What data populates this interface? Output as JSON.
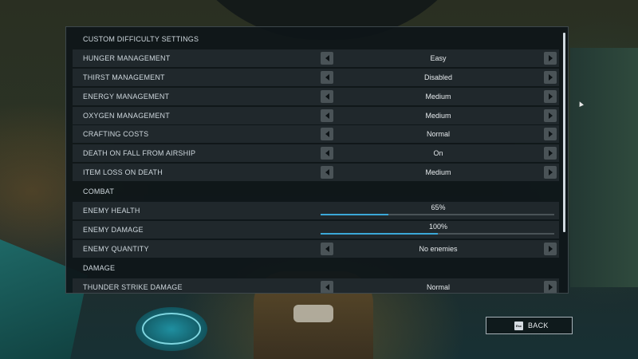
{
  "title": "CUSTOM DIFFICULTY SETTINGS",
  "rows": [
    {
      "label": "HUNGER MANAGEMENT",
      "value": "Easy"
    },
    {
      "label": "THIRST MANAGEMENT",
      "value": "Disabled"
    },
    {
      "label": "ENERGY MANAGEMENT",
      "value": "Medium"
    },
    {
      "label": "OXYGEN MANAGEMENT",
      "value": "Medium"
    },
    {
      "label": "CRAFTING COSTS",
      "value": "Normal"
    },
    {
      "label": "DEATH ON FALL FROM AIRSHIP",
      "value": "On"
    },
    {
      "label": "ITEM LOSS ON DEATH",
      "value": "Medium"
    }
  ],
  "combat": {
    "heading": "COMBAT",
    "enemy_health": {
      "label": "ENEMY HEALTH",
      "value": "65%",
      "level": 0.29
    },
    "enemy_damage": {
      "label": "ENEMY DAMAGE",
      "value": "100%",
      "level": 0.5
    },
    "enemy_quantity": {
      "label": "ENEMY QUANTITY",
      "value": "No enemies"
    }
  },
  "damage": {
    "heading": "DAMAGE",
    "thunder_strike": {
      "label": "THUNDER STRIKE DAMAGE",
      "value": "Normal"
    }
  },
  "back_button": {
    "key_hint": "Esc",
    "label": "BACK"
  },
  "colors": {
    "accent": "#3ba8d8",
    "row_bg": "#20282c",
    "panel_bg": "#0e1619"
  },
  "icons": [
    "chevron-left-icon",
    "chevron-right-icon",
    "esc-key-icon"
  ]
}
